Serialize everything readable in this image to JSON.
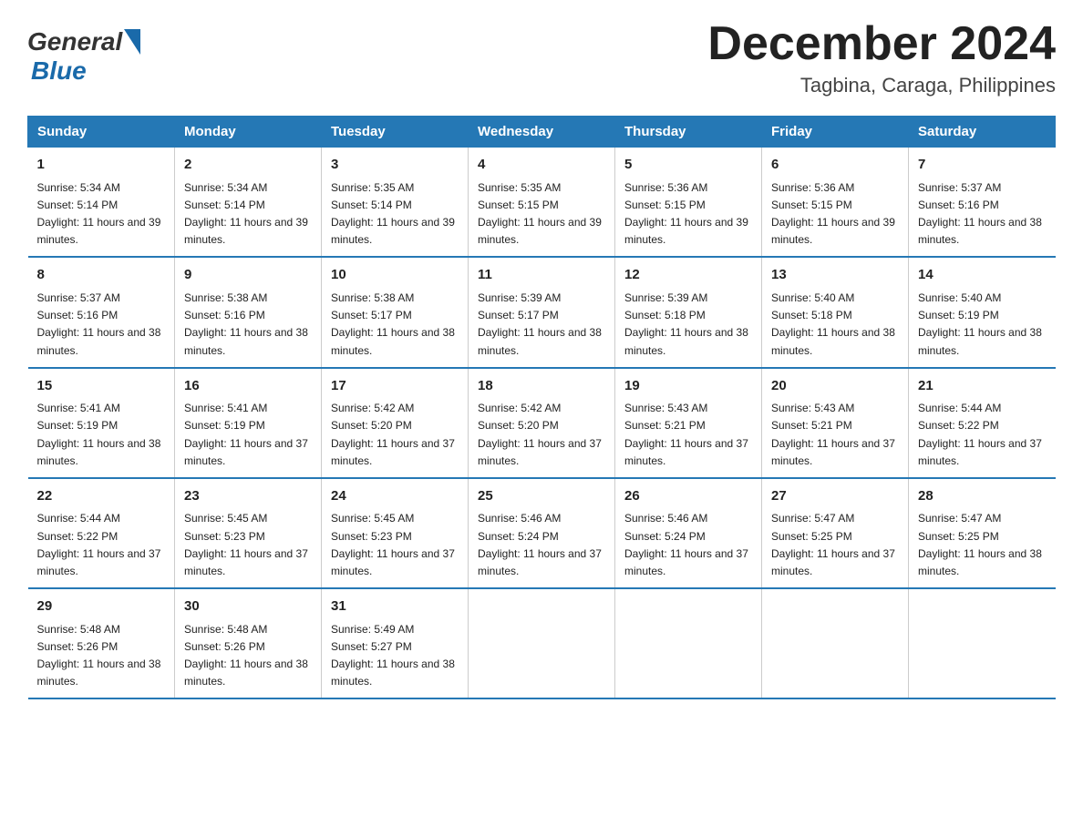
{
  "logo": {
    "general": "General",
    "blue": "Blue"
  },
  "title": "December 2024",
  "subtitle": "Tagbina, Caraga, Philippines",
  "weekdays": [
    "Sunday",
    "Monday",
    "Tuesday",
    "Wednesday",
    "Thursday",
    "Friday",
    "Saturday"
  ],
  "weeks": [
    [
      {
        "day": "1",
        "sunrise": "5:34 AM",
        "sunset": "5:14 PM",
        "daylight": "11 hours and 39 minutes."
      },
      {
        "day": "2",
        "sunrise": "5:34 AM",
        "sunset": "5:14 PM",
        "daylight": "11 hours and 39 minutes."
      },
      {
        "day": "3",
        "sunrise": "5:35 AM",
        "sunset": "5:14 PM",
        "daylight": "11 hours and 39 minutes."
      },
      {
        "day": "4",
        "sunrise": "5:35 AM",
        "sunset": "5:15 PM",
        "daylight": "11 hours and 39 minutes."
      },
      {
        "day": "5",
        "sunrise": "5:36 AM",
        "sunset": "5:15 PM",
        "daylight": "11 hours and 39 minutes."
      },
      {
        "day": "6",
        "sunrise": "5:36 AM",
        "sunset": "5:15 PM",
        "daylight": "11 hours and 39 minutes."
      },
      {
        "day": "7",
        "sunrise": "5:37 AM",
        "sunset": "5:16 PM",
        "daylight": "11 hours and 38 minutes."
      }
    ],
    [
      {
        "day": "8",
        "sunrise": "5:37 AM",
        "sunset": "5:16 PM",
        "daylight": "11 hours and 38 minutes."
      },
      {
        "day": "9",
        "sunrise": "5:38 AM",
        "sunset": "5:16 PM",
        "daylight": "11 hours and 38 minutes."
      },
      {
        "day": "10",
        "sunrise": "5:38 AM",
        "sunset": "5:17 PM",
        "daylight": "11 hours and 38 minutes."
      },
      {
        "day": "11",
        "sunrise": "5:39 AM",
        "sunset": "5:17 PM",
        "daylight": "11 hours and 38 minutes."
      },
      {
        "day": "12",
        "sunrise": "5:39 AM",
        "sunset": "5:18 PM",
        "daylight": "11 hours and 38 minutes."
      },
      {
        "day": "13",
        "sunrise": "5:40 AM",
        "sunset": "5:18 PM",
        "daylight": "11 hours and 38 minutes."
      },
      {
        "day": "14",
        "sunrise": "5:40 AM",
        "sunset": "5:19 PM",
        "daylight": "11 hours and 38 minutes."
      }
    ],
    [
      {
        "day": "15",
        "sunrise": "5:41 AM",
        "sunset": "5:19 PM",
        "daylight": "11 hours and 38 minutes."
      },
      {
        "day": "16",
        "sunrise": "5:41 AM",
        "sunset": "5:19 PM",
        "daylight": "11 hours and 37 minutes."
      },
      {
        "day": "17",
        "sunrise": "5:42 AM",
        "sunset": "5:20 PM",
        "daylight": "11 hours and 37 minutes."
      },
      {
        "day": "18",
        "sunrise": "5:42 AM",
        "sunset": "5:20 PM",
        "daylight": "11 hours and 37 minutes."
      },
      {
        "day": "19",
        "sunrise": "5:43 AM",
        "sunset": "5:21 PM",
        "daylight": "11 hours and 37 minutes."
      },
      {
        "day": "20",
        "sunrise": "5:43 AM",
        "sunset": "5:21 PM",
        "daylight": "11 hours and 37 minutes."
      },
      {
        "day": "21",
        "sunrise": "5:44 AM",
        "sunset": "5:22 PM",
        "daylight": "11 hours and 37 minutes."
      }
    ],
    [
      {
        "day": "22",
        "sunrise": "5:44 AM",
        "sunset": "5:22 PM",
        "daylight": "11 hours and 37 minutes."
      },
      {
        "day": "23",
        "sunrise": "5:45 AM",
        "sunset": "5:23 PM",
        "daylight": "11 hours and 37 minutes."
      },
      {
        "day": "24",
        "sunrise": "5:45 AM",
        "sunset": "5:23 PM",
        "daylight": "11 hours and 37 minutes."
      },
      {
        "day": "25",
        "sunrise": "5:46 AM",
        "sunset": "5:24 PM",
        "daylight": "11 hours and 37 minutes."
      },
      {
        "day": "26",
        "sunrise": "5:46 AM",
        "sunset": "5:24 PM",
        "daylight": "11 hours and 37 minutes."
      },
      {
        "day": "27",
        "sunrise": "5:47 AM",
        "sunset": "5:25 PM",
        "daylight": "11 hours and 37 minutes."
      },
      {
        "day": "28",
        "sunrise": "5:47 AM",
        "sunset": "5:25 PM",
        "daylight": "11 hours and 38 minutes."
      }
    ],
    [
      {
        "day": "29",
        "sunrise": "5:48 AM",
        "sunset": "5:26 PM",
        "daylight": "11 hours and 38 minutes."
      },
      {
        "day": "30",
        "sunrise": "5:48 AM",
        "sunset": "5:26 PM",
        "daylight": "11 hours and 38 minutes."
      },
      {
        "day": "31",
        "sunrise": "5:49 AM",
        "sunset": "5:27 PM",
        "daylight": "11 hours and 38 minutes."
      },
      null,
      null,
      null,
      null
    ]
  ]
}
